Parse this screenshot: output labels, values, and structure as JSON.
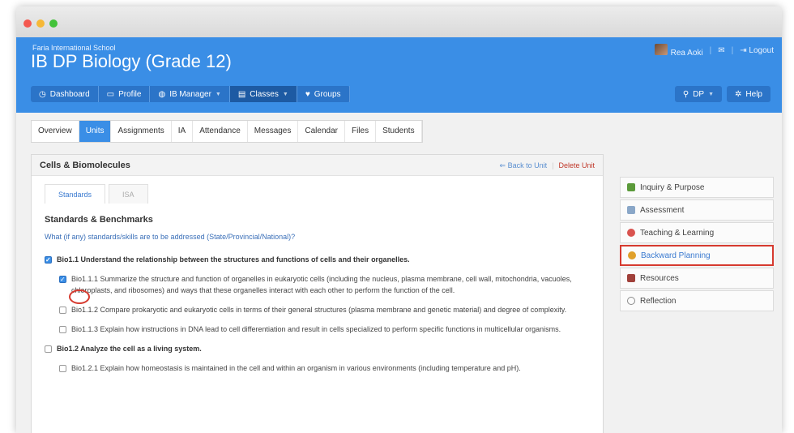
{
  "school": "Faria International School",
  "course": "IB DP Biology (Grade 12)",
  "user": {
    "name": "Rea Aoki",
    "logout": "Logout"
  },
  "nav": [
    {
      "label": "Dashboard",
      "icon": "dashboard-icon"
    },
    {
      "label": "Profile",
      "icon": "profile-icon"
    },
    {
      "label": "IB Manager",
      "icon": "globe-icon"
    },
    {
      "label": "Classes",
      "icon": "classes-icon"
    },
    {
      "label": "Groups",
      "icon": "groups-icon"
    }
  ],
  "nav_right": {
    "program": "DP",
    "help": "Help"
  },
  "tabs": [
    "Overview",
    "Units",
    "Assignments",
    "IA",
    "Attendance",
    "Messages",
    "Calendar",
    "Files",
    "Students"
  ],
  "panel": {
    "title": "Cells & Biomolecules",
    "back_link": "Back to Unit",
    "delete_link": "Delete Unit",
    "subtabs": [
      "Standards",
      "ISA"
    ],
    "heading": "Standards & Benchmarks",
    "question": "What (if any) standards/skills are to be addressed (State/Provincial/National)?",
    "standards": [
      {
        "text": "Bio1.1 Understand the relationship between the structures and functions of cells and their organelles.",
        "checked": true,
        "level": "main"
      },
      {
        "text": "Bio1.1.1 Summarize the structure and function of organelles in eukaryotic cells (including the nucleus, plasma membrane, cell wall, mitochondria, vacuoles, chloroplasts, and ribosomes) and ways that these organelles interact with each other to perform the function of the cell.",
        "checked": true,
        "level": "sub"
      },
      {
        "text": "Bio1.1.2 Compare prokaryotic and eukaryotic cells in terms of their general structures (plasma membrane and genetic material) and degree of complexity.",
        "checked": false,
        "level": "sub"
      },
      {
        "text": "Bio1.1.3 Explain how instructions in DNA lead to cell differentiation and result in cells specialized to perform specific functions in multicellular organisms.",
        "checked": false,
        "level": "sub"
      },
      {
        "text": "Bio1.2 Analyze the cell as a living system.",
        "checked": false,
        "level": "main"
      },
      {
        "text": "Bio1.2.1 Explain how homeostasis is maintained in the cell and within an organism in various environments (including temperature and pH).",
        "checked": false,
        "level": "sub"
      }
    ]
  },
  "sidebar": [
    {
      "label": "Inquiry & Purpose",
      "color": "#5b9a3a"
    },
    {
      "label": "Assessment",
      "color": "#8aa7c8"
    },
    {
      "label": "Teaching & Learning",
      "color": "#d9534f"
    },
    {
      "label": "Backward Planning",
      "color": "#e0a02a"
    },
    {
      "label": "Resources",
      "color": "#a0403a"
    },
    {
      "label": "Reflection",
      "color": "#8a8a8a"
    }
  ]
}
